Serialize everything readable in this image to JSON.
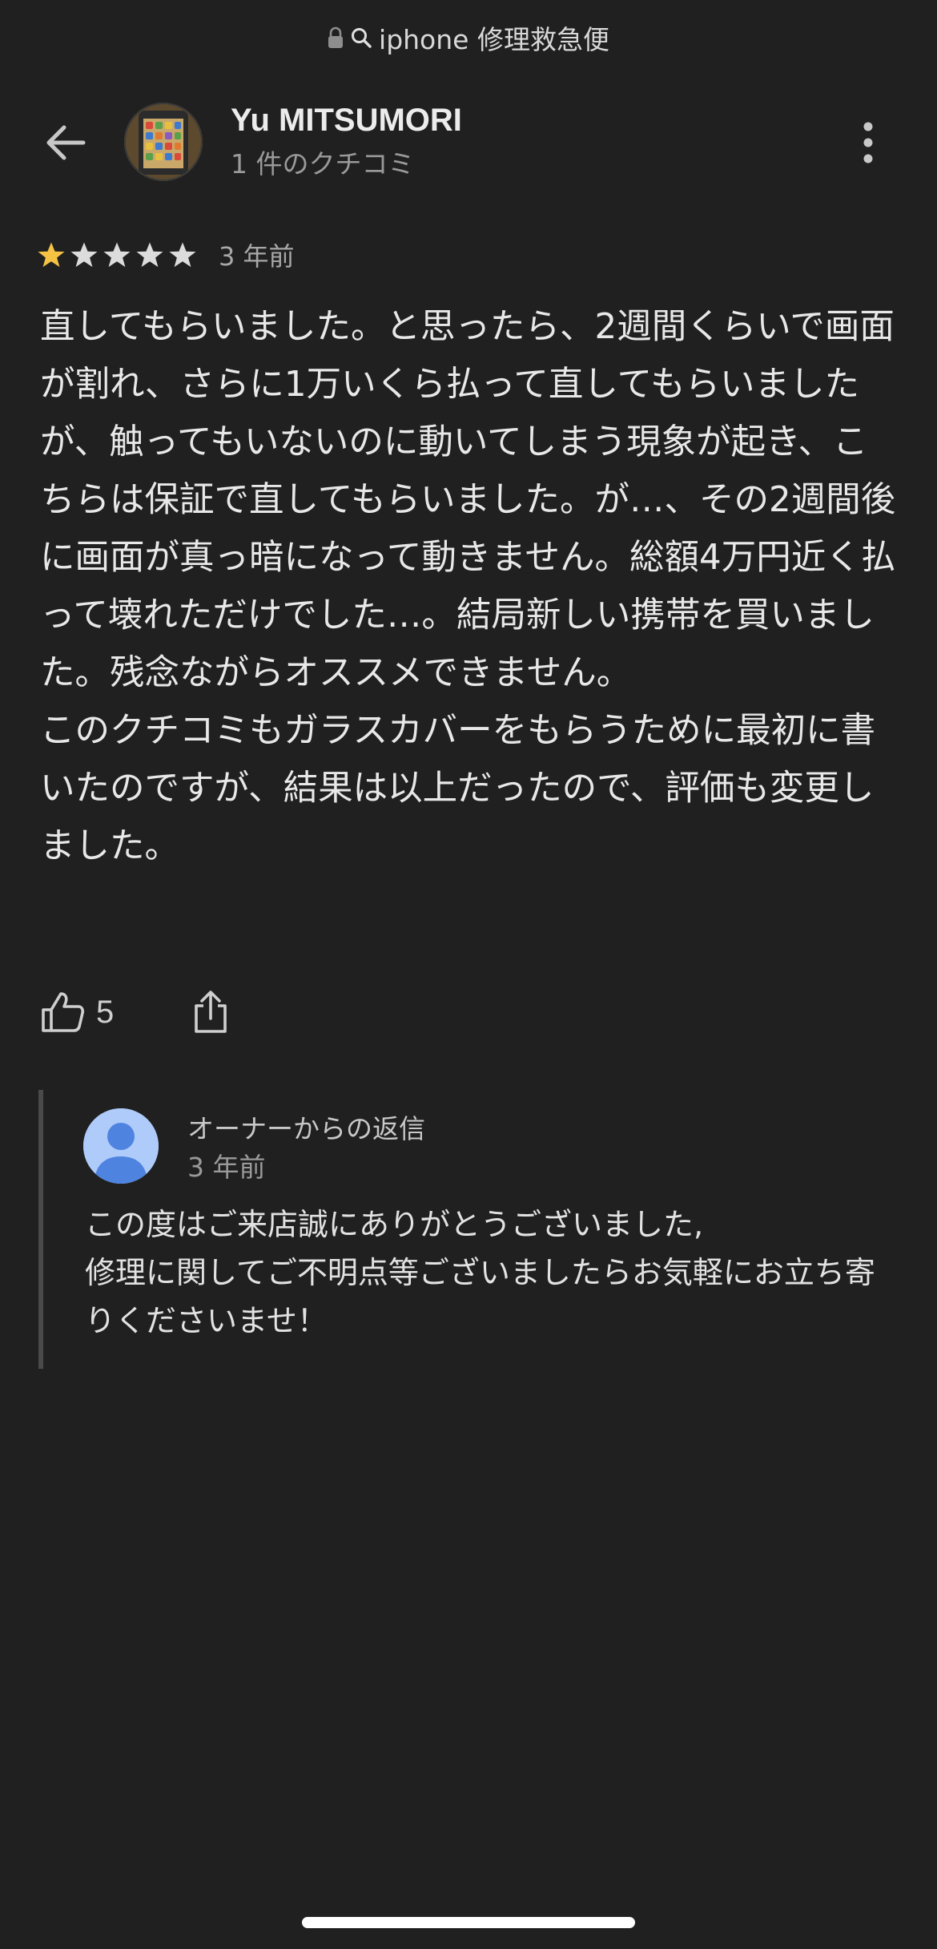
{
  "browser": {
    "lock_icon": "lock-icon",
    "search_icon": "search-icon",
    "url_text": "iphone 修理救急便"
  },
  "header": {
    "back_icon": "arrow-left-icon",
    "user_name": "Yu MITSUMORI",
    "review_count": "1 件のクチコミ",
    "more_icon": "more-vert-icon"
  },
  "review": {
    "rating": 1,
    "max_rating": 5,
    "time_ago": "3 年前",
    "text": "直してもらいました。と思ったら、2週間くらいで画面が割れ、さらに1万いくら払って直してもらいましたが、触ってもいないのに動いてしまう現象が起き、こちらは保証で直してもらいました。が…、その2週間後に画面が真っ暗になって動きません。総額4万円近く払って壊れただけでした…。結局新しい携帯を買いました。残念ながらオススメできません。\nこのクチコミもガラスカバーをもらうために最初に書いたのですが、結果は以上だったので、評価も変更しました。",
    "like_count": "5"
  },
  "owner_reply": {
    "title": "オーナーからの返信",
    "time_ago": "3 年前",
    "text": "この度はご来店誠にありがとうございました,\n修理に関してご不明点等ございましたらお気軽にお立ち寄りくださいませ！"
  },
  "colors": {
    "background": "#202020",
    "star_filled": "#f5c344",
    "star_empty": "#dcdcdc",
    "owner_avatar_bg": "#aecbfa",
    "owner_avatar_fg": "#4f83e0"
  }
}
